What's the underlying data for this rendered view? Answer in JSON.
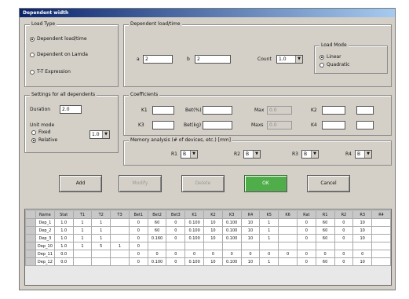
{
  "window": {
    "title": "Dependent width"
  },
  "load_type": {
    "group_label": "Load Type",
    "options": [
      {
        "label": "Dependent load/time",
        "selected": true
      },
      {
        "label": "Dependent on Lamda",
        "selected": false
      },
      {
        "label": "T-T Expression",
        "selected": false
      }
    ]
  },
  "settings": {
    "group_label": "Settings for all dependents",
    "duration_label": "Duration",
    "duration_value": "2.0",
    "unit_label": "Unit mode",
    "unit_options": [
      {
        "label": "Fixed",
        "selected": false
      },
      {
        "label": "Relative",
        "selected": true
      }
    ],
    "unit_combo": "1.0"
  },
  "dependent": {
    "group_label": "Dependent load/time",
    "a_label": "a",
    "a_value": "2",
    "b_label": "b",
    "b_value": "2",
    "count_label": "Count",
    "count_value": "1.0",
    "load_mode": {
      "label": "Load Mode",
      "options": [
        {
          "label": "Linear",
          "selected": true
        },
        {
          "label": "Quadratic",
          "selected": false
        }
      ]
    }
  },
  "coefficients": {
    "group_label": "Coefficients",
    "fields": [
      {
        "label": "K1",
        "value": ""
      },
      {
        "label": "Bet(%)",
        "value": ""
      },
      {
        "label": "Max",
        "value": "0.0",
        "disabled": true
      },
      {
        "label": "K2",
        "value": ""
      },
      {
        "label": "K3",
        "value": ""
      },
      {
        "label": "Bet(kg)",
        "value": ""
      },
      {
        "label": "Maxs",
        "value": "0.0",
        "disabled": true
      },
      {
        "label": "K4",
        "value": ""
      }
    ],
    "extra_fields": [
      "",
      ""
    ]
  },
  "memory": {
    "group_label": "Memory analysis (# of devices, etc.) [mm]",
    "combos": [
      {
        "label": "R1",
        "value": "B"
      },
      {
        "label": "R2",
        "value": "B"
      },
      {
        "label": "R3",
        "value": "B"
      },
      {
        "label": "R4",
        "value": "B"
      }
    ]
  },
  "buttons": [
    {
      "label": "Add",
      "disabled": false
    },
    {
      "label": "Modify",
      "disabled": true
    },
    {
      "label": "Delete",
      "disabled": true
    },
    {
      "label": "OK",
      "disabled": false,
      "primary": true
    },
    {
      "label": "Cancel",
      "disabled": false
    }
  ],
  "table": {
    "headers": [
      "Name",
      "Stat",
      "T1",
      "T2",
      "T3",
      "Bet1",
      "Bet2",
      "Bet3",
      "K1",
      "K2",
      "K3",
      "K4",
      "K5",
      "K6",
      "Rat",
      "R1",
      "R2",
      "R3",
      "R4"
    ],
    "rows": [
      [
        "Dep_1",
        "1.0",
        "1",
        "1",
        "",
        "0",
        "60",
        "0",
        "0.100",
        "10",
        "0.100",
        "10",
        "1",
        "",
        "0",
        "60",
        "0",
        "10"
      ],
      [
        "Dep_2",
        "1.0",
        "1",
        "1",
        "",
        "0",
        "60",
        "0",
        "0.100",
        "10",
        "0.100",
        "10",
        "1",
        "",
        "0",
        "60",
        "0",
        "10"
      ],
      [
        "Dep_3",
        "1.0",
        "1",
        "1",
        "",
        "0",
        "0.160",
        "0",
        "0.100",
        "10",
        "0.100",
        "10",
        "1",
        "",
        "0",
        "60",
        "0",
        "10"
      ],
      [
        "Dep_10",
        "1.0",
        "1",
        "5",
        "1",
        "0",
        "",
        "",
        "",
        "",
        "",
        "",
        "",
        "",
        "",
        "",
        "",
        ""
      ],
      [
        "Dep_11",
        "0.0",
        "",
        "",
        "",
        "0",
        "0",
        "0",
        "0",
        "0",
        "0",
        "0",
        "0",
        "0",
        "0",
        "0",
        "0",
        "0"
      ],
      [
        "Dep_12",
        "0.0",
        "",
        "",
        "",
        "0",
        "0.100",
        "0",
        "0.100",
        "10",
        "0.100",
        "10",
        "1",
        "",
        "0",
        "60",
        "0",
        "10"
      ]
    ]
  }
}
